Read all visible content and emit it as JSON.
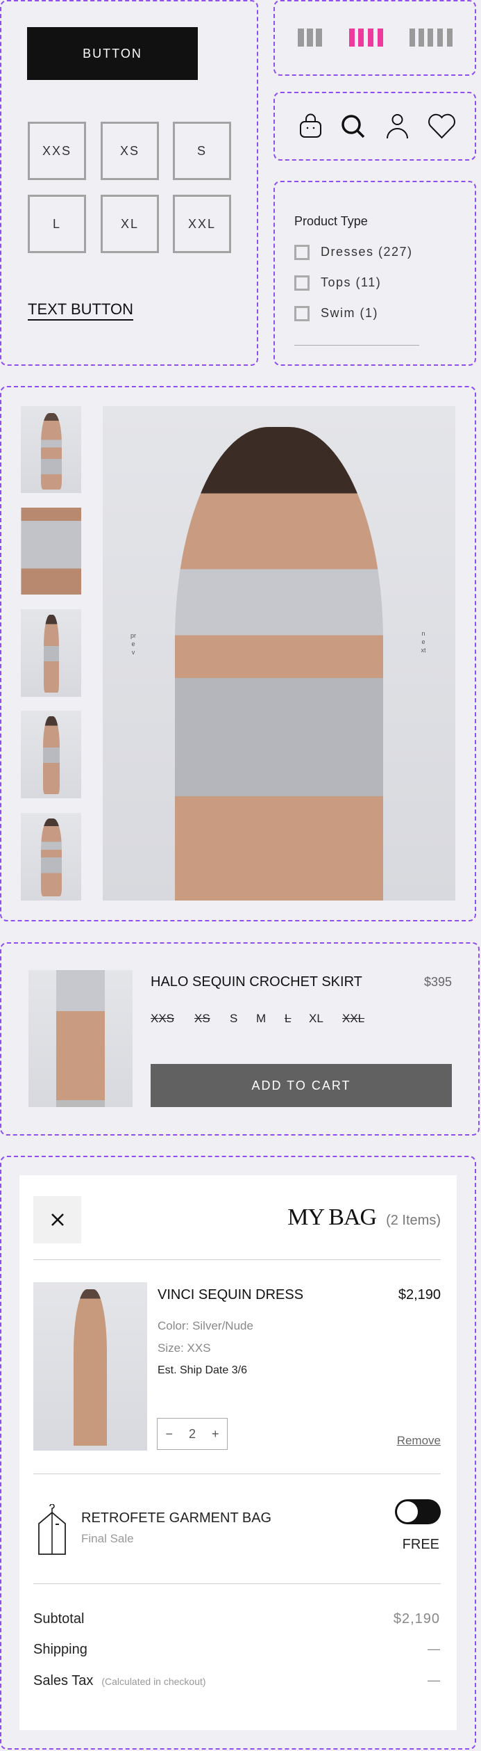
{
  "components": {
    "primary_button": "BUTTON",
    "sizes": [
      "XXS",
      "XS",
      "S",
      "L",
      "XL",
      "XXL"
    ],
    "text_button": "TEXT BUTTON",
    "grid_toggles": [
      {
        "name": "grid-3",
        "bars": 3,
        "color": "#9a9a9a",
        "active": false
      },
      {
        "name": "grid-4",
        "bars": 4,
        "color": "#ee3a9c",
        "active": true
      },
      {
        "name": "grid-5",
        "bars": 5,
        "color": "#9a9a9a",
        "active": false
      }
    ],
    "header_icons": [
      "shopping-bag-icon",
      "search-icon",
      "user-icon",
      "heart-icon"
    ],
    "filter": {
      "title": "Product Type",
      "options": [
        {
          "label": "Dresses (227)",
          "checked": false
        },
        {
          "label": "Tops (11)",
          "checked": false
        },
        {
          "label": "Swim (1)",
          "checked": false
        }
      ]
    }
  },
  "gallery": {
    "thumbnail_count": 5,
    "prev_label": "prev",
    "next_label": "next"
  },
  "quick_add": {
    "title": "HALO SEQUIN CROCHET SKIRT",
    "price": "$395",
    "sizes": [
      {
        "label": "XXS",
        "available": false
      },
      {
        "label": "XS",
        "available": false
      },
      {
        "label": "S",
        "available": true
      },
      {
        "label": "M",
        "available": true
      },
      {
        "label": "L",
        "available": false
      },
      {
        "label": "XL",
        "available": true
      },
      {
        "label": "XXL",
        "available": false
      }
    ],
    "add_to_cart": "ADD TO CART"
  },
  "bag": {
    "close_icon": "close-icon",
    "title": "MY BAG",
    "count": "(2 Items)",
    "item": {
      "name": "VINCI SEQUIN DRESS",
      "price": "$2,190",
      "color": "Color: Silver/Nude",
      "size": "Size: XXS",
      "ship_date": "Est. Ship Date 3/6",
      "quantity": "2",
      "minus": "−",
      "plus": "+",
      "remove": "Remove"
    },
    "garment_bag": {
      "title": "RETROFETE GARMENT BAG",
      "subtitle": "Final Sale",
      "price": "FREE",
      "toggle_on": false
    },
    "summary": {
      "subtotal_label": "Subtotal",
      "subtotal_value": "$2,190",
      "shipping_label": "Shipping",
      "shipping_value": "—",
      "tax_label": "Sales Tax",
      "tax_note": "(Calculated in checkout)",
      "tax_value": "—"
    }
  },
  "colors": {
    "accent": "#ee3a9c",
    "dashed_border": "#8f4ff0",
    "button_dark": "#111111",
    "button_gray": "#616161"
  }
}
